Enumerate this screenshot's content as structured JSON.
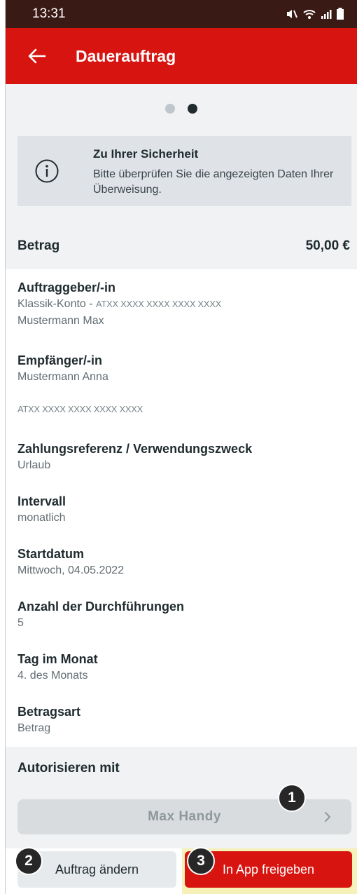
{
  "status_bar": {
    "time": "13:31"
  },
  "header": {
    "title": "Dauerauftrag",
    "back_icon": "arrow-left-icon"
  },
  "pager": {
    "page_count": 2,
    "active_index": 1
  },
  "security_notice": {
    "title": "Zu Ihrer Sicherheit",
    "text": "Bitte überprüfen Sie die angezeigten Daten Ihrer Überweisung.",
    "icon": "info-icon"
  },
  "amount": {
    "label": "Betrag",
    "value": "50,00 €"
  },
  "details": {
    "payer_label": "Auftraggeber/-in",
    "payer_account": "Klassik-Konto -",
    "payer_iban": "ATXX XXXX XXXX XXXX XXXX",
    "payer_name": "Mustermann Max",
    "payee_label": "Empfänger/-in",
    "payee_name": "Mustermann Anna",
    "payee_iban": "ATXX XXXX XXXX XXXX XXXX",
    "reference_label": "Zahlungsreferenz / Verwendungszweck",
    "reference_value": "Urlaub",
    "interval_label": "Intervall",
    "interval_value": "monatlich",
    "start_label": "Startdatum",
    "start_value": "Mittwoch, 04.05.2022",
    "executions_label": "Anzahl der Durchführungen",
    "executions_value": "5",
    "day_label": "Tag im Monat",
    "day_value": "4. des Monats",
    "amount_type_label": "Betragsart",
    "amount_type_value": "Betrag"
  },
  "authorization": {
    "title": "Autorisieren mit",
    "device": "Max Handy"
  },
  "actions": {
    "change_label": "Auftrag ändern",
    "release_label": "In App freigeben"
  },
  "badges": [
    "1",
    "2",
    "3"
  ],
  "colors": {
    "brand_red": "#d7140f",
    "status_bar": "#3a1a14",
    "background_gray": "#f0f2f4",
    "highlight_yellow": "#f6f1b8",
    "badge": "#272727"
  }
}
